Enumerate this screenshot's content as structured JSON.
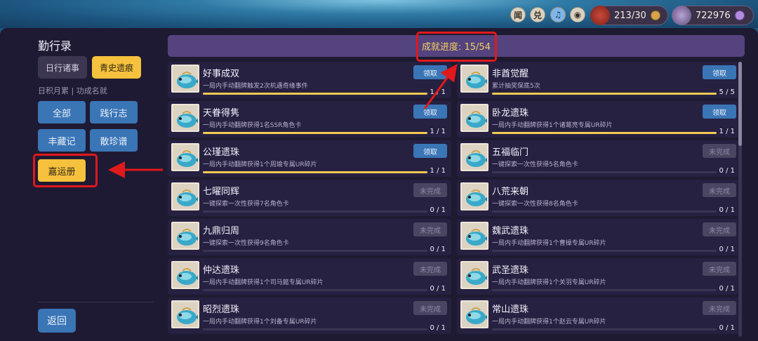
{
  "topbar": {
    "icons": [
      {
        "label": "闻",
        "name": "news-icon"
      },
      {
        "label": "兑",
        "name": "exchange-icon"
      },
      {
        "label": "♫",
        "name": "music-icon"
      },
      {
        "label": "◉",
        "name": "eye-icon"
      }
    ],
    "stamina": "213/30",
    "currency": "722976"
  },
  "sidebar": {
    "title": "勤行录",
    "tabs": [
      "日行诸事",
      "青史遗痕"
    ],
    "subtitle": "日积月累 | 功成名就",
    "categories": [
      "全部",
      "践行志",
      "丰藏记",
      "散珍谱",
      "嘉运册"
    ],
    "back": "返回"
  },
  "progress": "成就进度: 15/54",
  "achievements": [
    {
      "name": "好事成双",
      "desc": "一局内手动翻牌触发2次机遇奇缘事件",
      "button": "领取",
      "state": "claim",
      "count": "1 / 1",
      "progress": 1
    },
    {
      "name": "非酋觉醒",
      "desc": "累计抽奖保底5次",
      "button": "领取",
      "state": "claim",
      "count": "5 / 5",
      "progress": 1
    },
    {
      "name": "天眷得隽",
      "desc": "一局内手动翻牌获得1名SSR角色卡",
      "button": "领取",
      "state": "claim",
      "count": "1 / 1",
      "progress": 1
    },
    {
      "name": "卧龙遗珠",
      "desc": "一局内手动翻牌获得1个诸葛亮专属UR碎片",
      "button": "领取",
      "state": "claim",
      "count": "1 / 1",
      "progress": 1
    },
    {
      "name": "公瑾遗珠",
      "desc": "一局内手动翻牌获得1个周瑜专属UR碎片",
      "button": "领取",
      "state": "claim",
      "count": "1 / 1",
      "progress": 1
    },
    {
      "name": "五福临门",
      "desc": "一键探索一次性获得5名角色卡",
      "button": "未完成",
      "state": "todo",
      "count": "0 / 1",
      "progress": 0
    },
    {
      "name": "七曜同辉",
      "desc": "一键探索一次性获得7名角色卡",
      "button": "未完成",
      "state": "todo",
      "count": "0 / 1",
      "progress": 0
    },
    {
      "name": "八荒来朝",
      "desc": "一键探索一次性获得8名角色卡",
      "button": "未完成",
      "state": "todo",
      "count": "0 / 1",
      "progress": 0
    },
    {
      "name": "九鼎归周",
      "desc": "一键探索一次性获得9名角色卡",
      "button": "未完成",
      "state": "todo",
      "count": "0 / 1",
      "progress": 0
    },
    {
      "name": "魏武遗珠",
      "desc": "一局内手动翻牌获得1个曹操专属UR碎片",
      "button": "未完成",
      "state": "todo",
      "count": "0 / 1",
      "progress": 0
    },
    {
      "name": "仲达遗珠",
      "desc": "一局内手动翻牌获得1个司马懿专属UR碎片",
      "button": "未完成",
      "state": "todo",
      "count": "0 / 1",
      "progress": 0
    },
    {
      "name": "武圣遗珠",
      "desc": "一局内手动翻牌获得1个关羽专属UR碎片",
      "button": "未完成",
      "state": "todo",
      "count": "0 / 1",
      "progress": 0
    },
    {
      "name": "昭烈遗珠",
      "desc": "一局内手动翻牌获得1个刘备专属UR碎片",
      "button": "未完成",
      "state": "todo",
      "count": "0 / 1",
      "progress": 0
    },
    {
      "name": "常山遗珠",
      "desc": "一局内手动翻牌获得1个赵云专属UR碎片",
      "button": "未完成",
      "state": "todo",
      "count": "0 / 1",
      "progress": 0
    }
  ],
  "colors": {
    "accent": "#f6c13c",
    "claim": "#3a75b6",
    "highlight": "#e0191b"
  }
}
